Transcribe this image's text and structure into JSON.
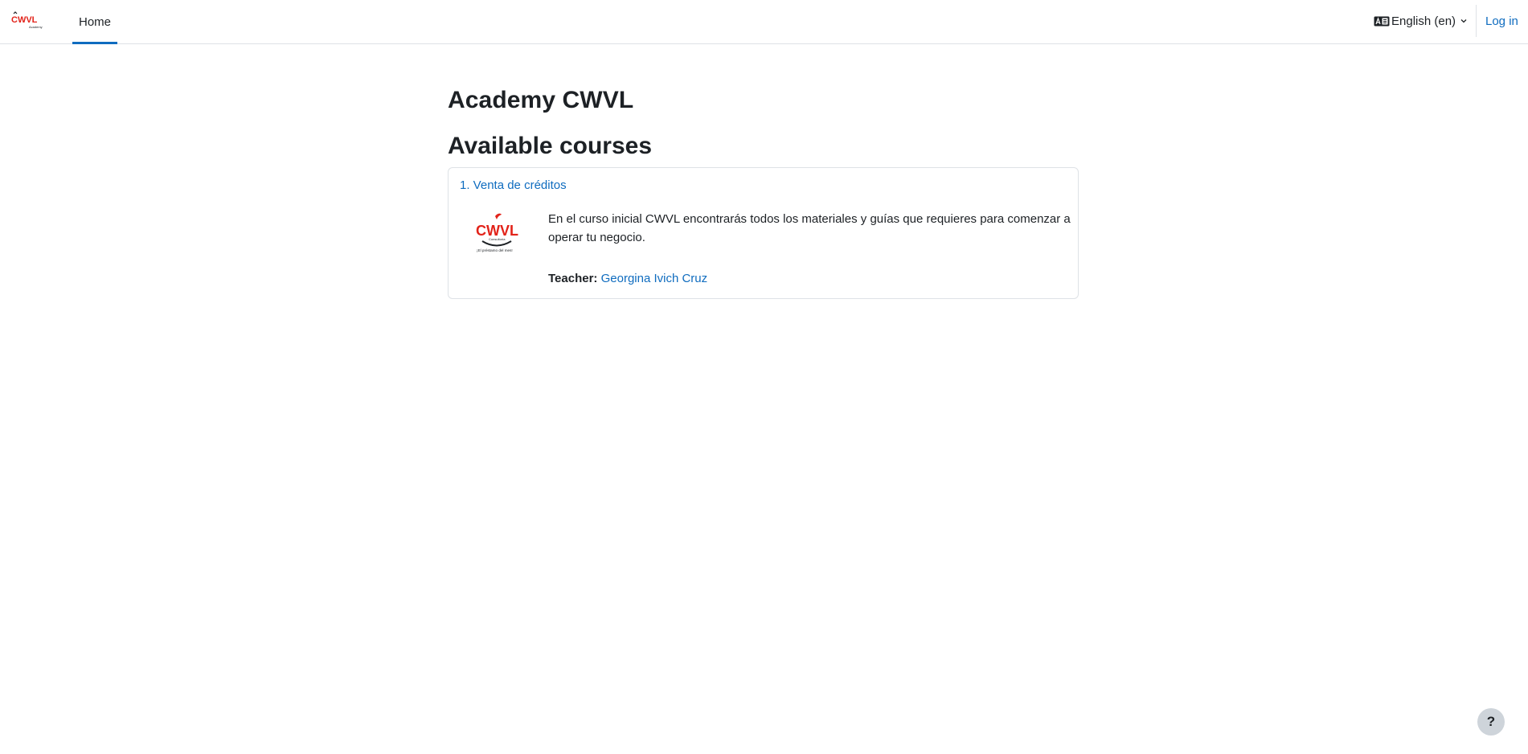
{
  "navbar": {
    "brand_text": "CWVL",
    "brand_subtext": "Academy",
    "home_label": "Home",
    "language_label": "English (en)",
    "login_label": "Log in"
  },
  "main": {
    "site_title": "Academy CWVL",
    "section_title": "Available courses",
    "courses": [
      {
        "name": "1. Venta de créditos",
        "image_brand_text": "CWVL",
        "image_tagline": "¡El préstamo del mes!",
        "summary": "En el curso inicial CWVL encontrarás todos los materiales y guías que requieres para comenzar a operar tu negocio.",
        "teacher_label": "Teacher:",
        "teacher_name": "Georgina Ivich Cruz"
      }
    ]
  },
  "help": {
    "label": "?"
  },
  "colors": {
    "accent": "#0f6cbf",
    "brand_red": "#e2231a",
    "text": "#1d2125",
    "border": "#dee2e6"
  },
  "icons": {
    "language": "language-icon",
    "dropdown": "chevron-down-icon",
    "help": "question-icon"
  }
}
